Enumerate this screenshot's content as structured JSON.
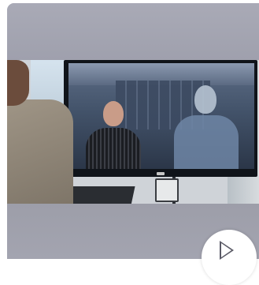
{
  "video_card": {
    "thumbnail_label": "",
    "play_icon": "play-icon",
    "colors": {
      "card_background": "#a4a5b2",
      "play_button": "#ffffff",
      "play_glyph": "#5a5a66"
    }
  }
}
